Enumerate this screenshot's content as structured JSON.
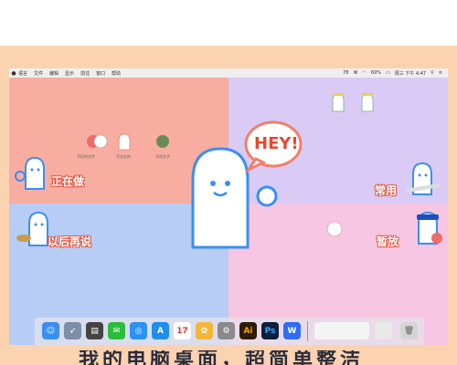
{
  "menubar": {
    "items": [
      "语言",
      "文件",
      "编辑",
      "显示",
      "前往",
      "窗口",
      "帮助"
    ],
    "status": {
      "battery": "69%",
      "clock": "周三 下午 4:47",
      "input": "78",
      "keyboard": "⌘"
    }
  },
  "desktop": {
    "labels": {
      "working": "正在做",
      "common": "常用",
      "later": "以后再说",
      "paused": "暂放"
    },
    "bubble_text": "HEY!",
    "small_icon_labels": [
      "写好的文件",
      "写论文的",
      "写的文字"
    ]
  },
  "dock": {
    "icons": [
      {
        "name": "finder-icon",
        "color": "#3b8ff0",
        "glyph": "☺"
      },
      {
        "name": "launchpad-icon",
        "color": "#7b8fa8",
        "glyph": "🚀"
      },
      {
        "name": "notes-icon",
        "color": "#444444",
        "glyph": "▤"
      },
      {
        "name": "wechat-icon",
        "color": "#2bbd3c",
        "glyph": "✉"
      },
      {
        "name": "safari-icon",
        "color": "#2b92f0",
        "glyph": "◎"
      },
      {
        "name": "appstore-icon",
        "color": "#1f8ef0",
        "glyph": "A"
      },
      {
        "name": "calendar-icon",
        "color": "#ffffff",
        "glyph": "17"
      },
      {
        "name": "photos-icon",
        "color": "#f3b63a",
        "glyph": "✿"
      },
      {
        "name": "settings-icon",
        "color": "#8a8a8a",
        "glyph": "⚙"
      },
      {
        "name": "illustrator-icon",
        "color": "#2e1a0a",
        "glyph": "Ai"
      },
      {
        "name": "photoshop-icon",
        "color": "#0d1e3b",
        "glyph": "Ps"
      },
      {
        "name": "wps-icon",
        "color": "#2f6cf5",
        "glyph": "W"
      }
    ]
  },
  "caption": {
    "text": "我的电脑桌面，超简单整洁"
  }
}
